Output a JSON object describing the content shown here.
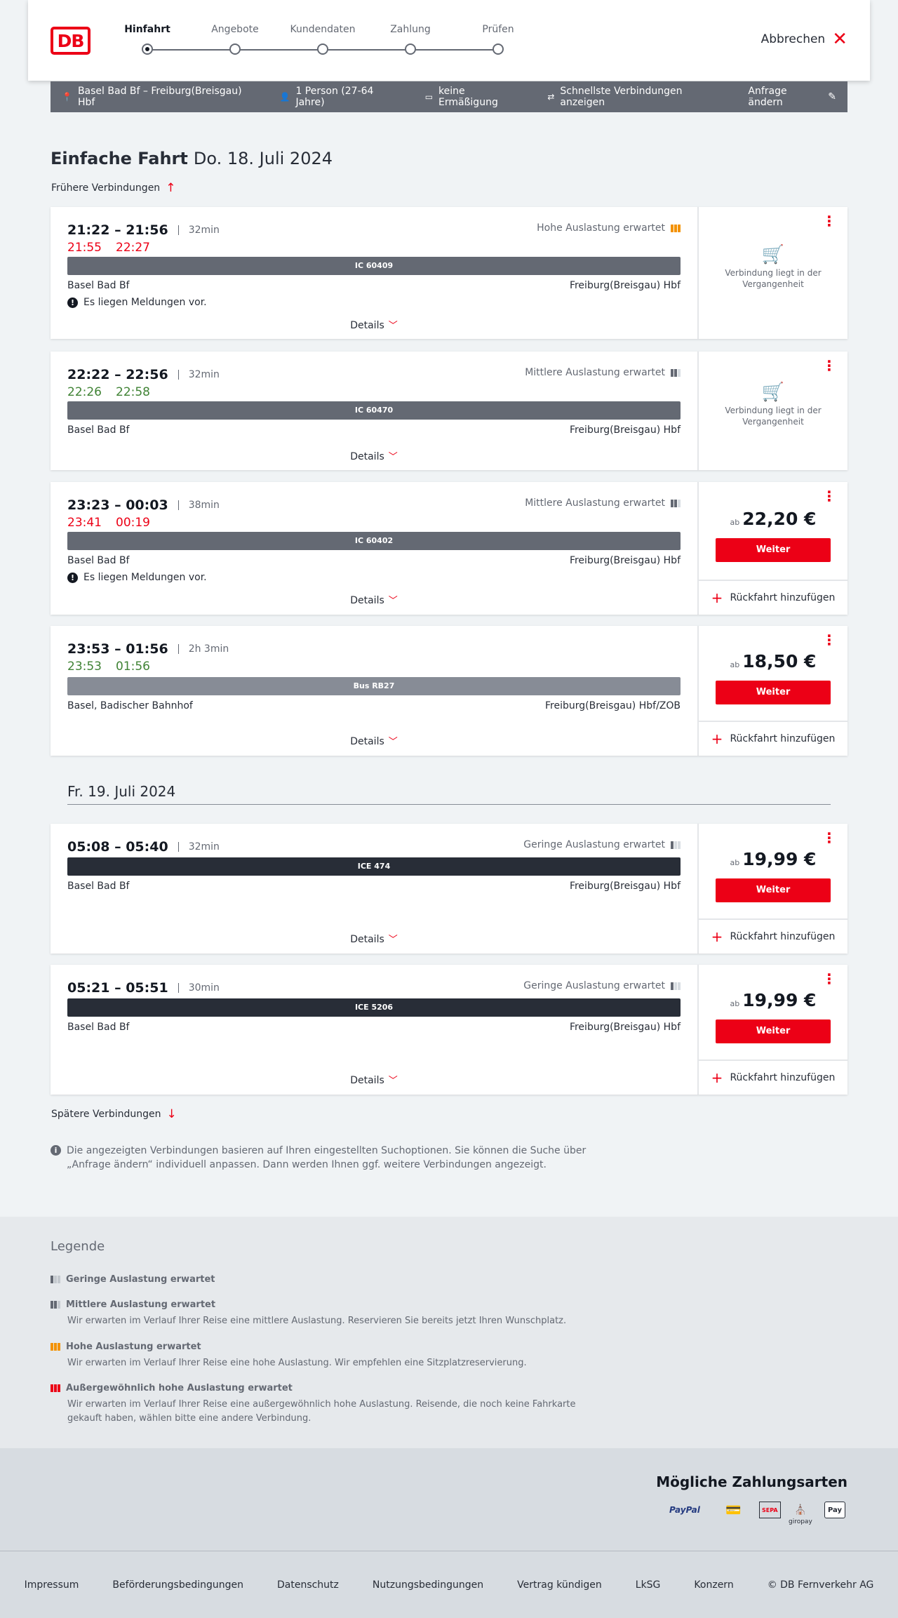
{
  "header": {
    "logo": "DB",
    "steps": [
      "Hinfahrt",
      "Angebote",
      "Kundendaten",
      "Zahlung",
      "Prüfen"
    ],
    "cancel_label": "Abbrechen"
  },
  "query": {
    "route": "Basel Bad Bf – Freiburg(Breisgau) Hbf",
    "passengers": "1 Person (27-64 Jahre)",
    "discount": "keine Ermäßigung",
    "fastest": "Schnellste Verbindungen anzeigen",
    "edit_label": "Anfrage ändern"
  },
  "page": {
    "title": "Einfache Fahrt",
    "date": "Do. 18. Juli 2024",
    "earlier_label": "Frühere Verbindungen",
    "later_label": "Spätere Verbindungen",
    "next_day": "Fr. 19. Juli 2024",
    "info_text": "Die angezeigten Verbindungen basieren auf Ihren eingestellten Suchoptionen. Sie können die Suche über „Anfrage ändern“ individuell anpassen. Dann werden Ihnen ggf. weitere Verbindungen angezeigt."
  },
  "common": {
    "details_label": "Details",
    "weiter_label": "Weiter",
    "return_label": "Rückfahrt hinzufügen",
    "ab_label": "ab",
    "past_text": "Verbindung liegt in der Vergangenheit",
    "messages_text": "Es liegen Meldungen vor."
  },
  "connections": [
    {
      "times": "21:22 – 21:56",
      "duration": "32min",
      "realtime": [
        "21:55",
        "22:27"
      ],
      "realtime_status": "late",
      "occupancy": "Hohe Auslastung erwartet",
      "occupancy_level": 3,
      "train": "IC 60409",
      "train_type": "ic",
      "from": "Basel Bad Bf",
      "to": "Freiburg(Breisgau) Hbf",
      "has_messages": true,
      "state": "past"
    },
    {
      "times": "22:22 – 22:56",
      "duration": "32min",
      "realtime": [
        "22:26",
        "22:58"
      ],
      "realtime_status": "ok",
      "occupancy": "Mittlere Auslastung erwartet",
      "occupancy_level": 2,
      "train": "IC 60470",
      "train_type": "ic",
      "from": "Basel Bad Bf",
      "to": "Freiburg(Breisgau) Hbf",
      "has_messages": false,
      "state": "past"
    },
    {
      "times": "23:23 – 00:03",
      "duration": "38min",
      "realtime": [
        "23:41",
        "00:19"
      ],
      "realtime_status": "late",
      "occupancy": "Mittlere Auslastung erwartet",
      "occupancy_level": 2,
      "train": "IC 60402",
      "train_type": "ic",
      "from": "Basel Bad Bf",
      "to": "Freiburg(Breisgau) Hbf",
      "has_messages": true,
      "state": "bookable",
      "price": "22,20 €"
    },
    {
      "times": "23:53 – 01:56",
      "duration": "2h 3min",
      "realtime": [
        "23:53",
        "01:56"
      ],
      "realtime_status": "ok",
      "occupancy": "",
      "occupancy_level": 0,
      "train": "Bus RB27",
      "train_type": "bus",
      "from": "Basel, Badischer Bahnhof",
      "to": "Freiburg(Breisgau) Hbf/ZOB",
      "has_messages": false,
      "state": "bookable",
      "price": "18,50 €"
    },
    {
      "times": "05:08 – 05:40",
      "duration": "32min",
      "realtime": [],
      "realtime_status": "",
      "occupancy": "Geringe Auslastung erwartet",
      "occupancy_level": 1,
      "train": "ICE 474",
      "train_type": "ice",
      "from": "Basel Bad Bf",
      "to": "Freiburg(Breisgau) Hbf",
      "has_messages": false,
      "state": "bookable",
      "price": "19,99 €"
    },
    {
      "times": "05:21 – 05:51",
      "duration": "30min",
      "realtime": [],
      "realtime_status": "",
      "occupancy": "Geringe Auslastung erwartet",
      "occupancy_level": 1,
      "train": "ICE 5206",
      "train_type": "ice",
      "from": "Basel Bad Bf",
      "to": "Freiburg(Breisgau) Hbf",
      "has_messages": false,
      "state": "bookable",
      "price": "19,99 €"
    }
  ],
  "legend": {
    "title": "Legende",
    "items": [
      {
        "label": "Geringe Auslastung erwartet",
        "desc": ""
      },
      {
        "label": "Mittlere Auslastung erwartet",
        "desc": "Wir erwarten im Verlauf Ihrer Reise eine mittlere Auslastung. Reservieren Sie bereits jetzt Ihren Wunschplatz."
      },
      {
        "label": "Hohe Auslastung erwartet",
        "desc": "Wir erwarten im Verlauf Ihrer Reise eine hohe Auslastung. Wir empfehlen eine Sitzplatzreservierung."
      },
      {
        "label": "Außergewöhnlich hohe Auslastung erwartet",
        "desc": "Wir erwarten im Verlauf Ihrer Reise eine außergewöhnlich hohe Auslastung. Reisende, die noch keine Fahrkarte gekauft haben, wählen bitte eine andere Verbindung."
      }
    ]
  },
  "payment": {
    "title": "Mögliche Zahlungsarten",
    "methods": [
      "PayPal",
      "",
      "SEPA",
      "giropay",
      "Pay"
    ]
  },
  "footer": {
    "links": [
      "Impressum",
      "Beförderungsbedingungen",
      "Datenschutz",
      "Nutzungsbedingungen",
      "Vertrag kündigen",
      "LkSG",
      "Konzern",
      "© DB Fernverkehr AG"
    ]
  },
  "colors": {
    "brand": "#ec0016",
    "late": "#ec0016",
    "ontime": "#408335",
    "high_occupancy": "#f39200"
  }
}
